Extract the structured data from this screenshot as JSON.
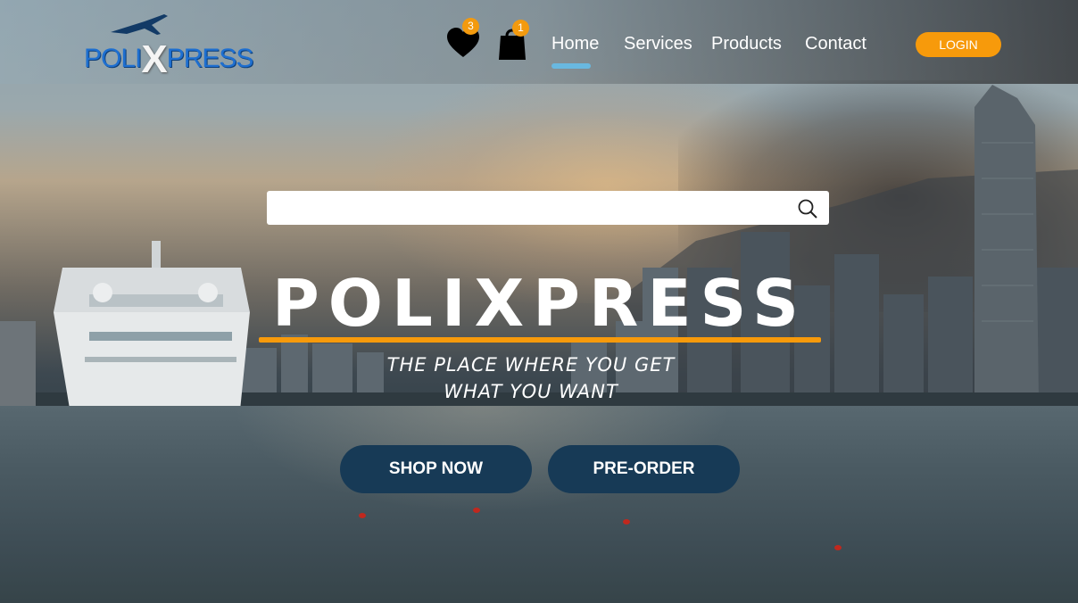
{
  "nav": {
    "logo": {
      "left": "POLI",
      "x": "X",
      "right": "PRESS"
    },
    "wishlist_count": "3",
    "cart_count": "1",
    "links": [
      "Home",
      "Services",
      "Products",
      "Contact"
    ],
    "active_link": "Home",
    "login_label": "LOGIN"
  },
  "search": {
    "placeholder": "",
    "value": ""
  },
  "hero": {
    "title": "POLIXPRESS",
    "tagline_line1": "THE PLACE WHERE YOU GET",
    "tagline_line2": "WHAT YOU WANT",
    "shop_now_label": "SHOP NOW",
    "preorder_label": "PRE-ORDER"
  },
  "colors": {
    "accent_orange": "#f79a0b",
    "button_navy": "#173a56",
    "logo_blue": "#1e6fd0",
    "active_indicator": "#69b8e0"
  }
}
